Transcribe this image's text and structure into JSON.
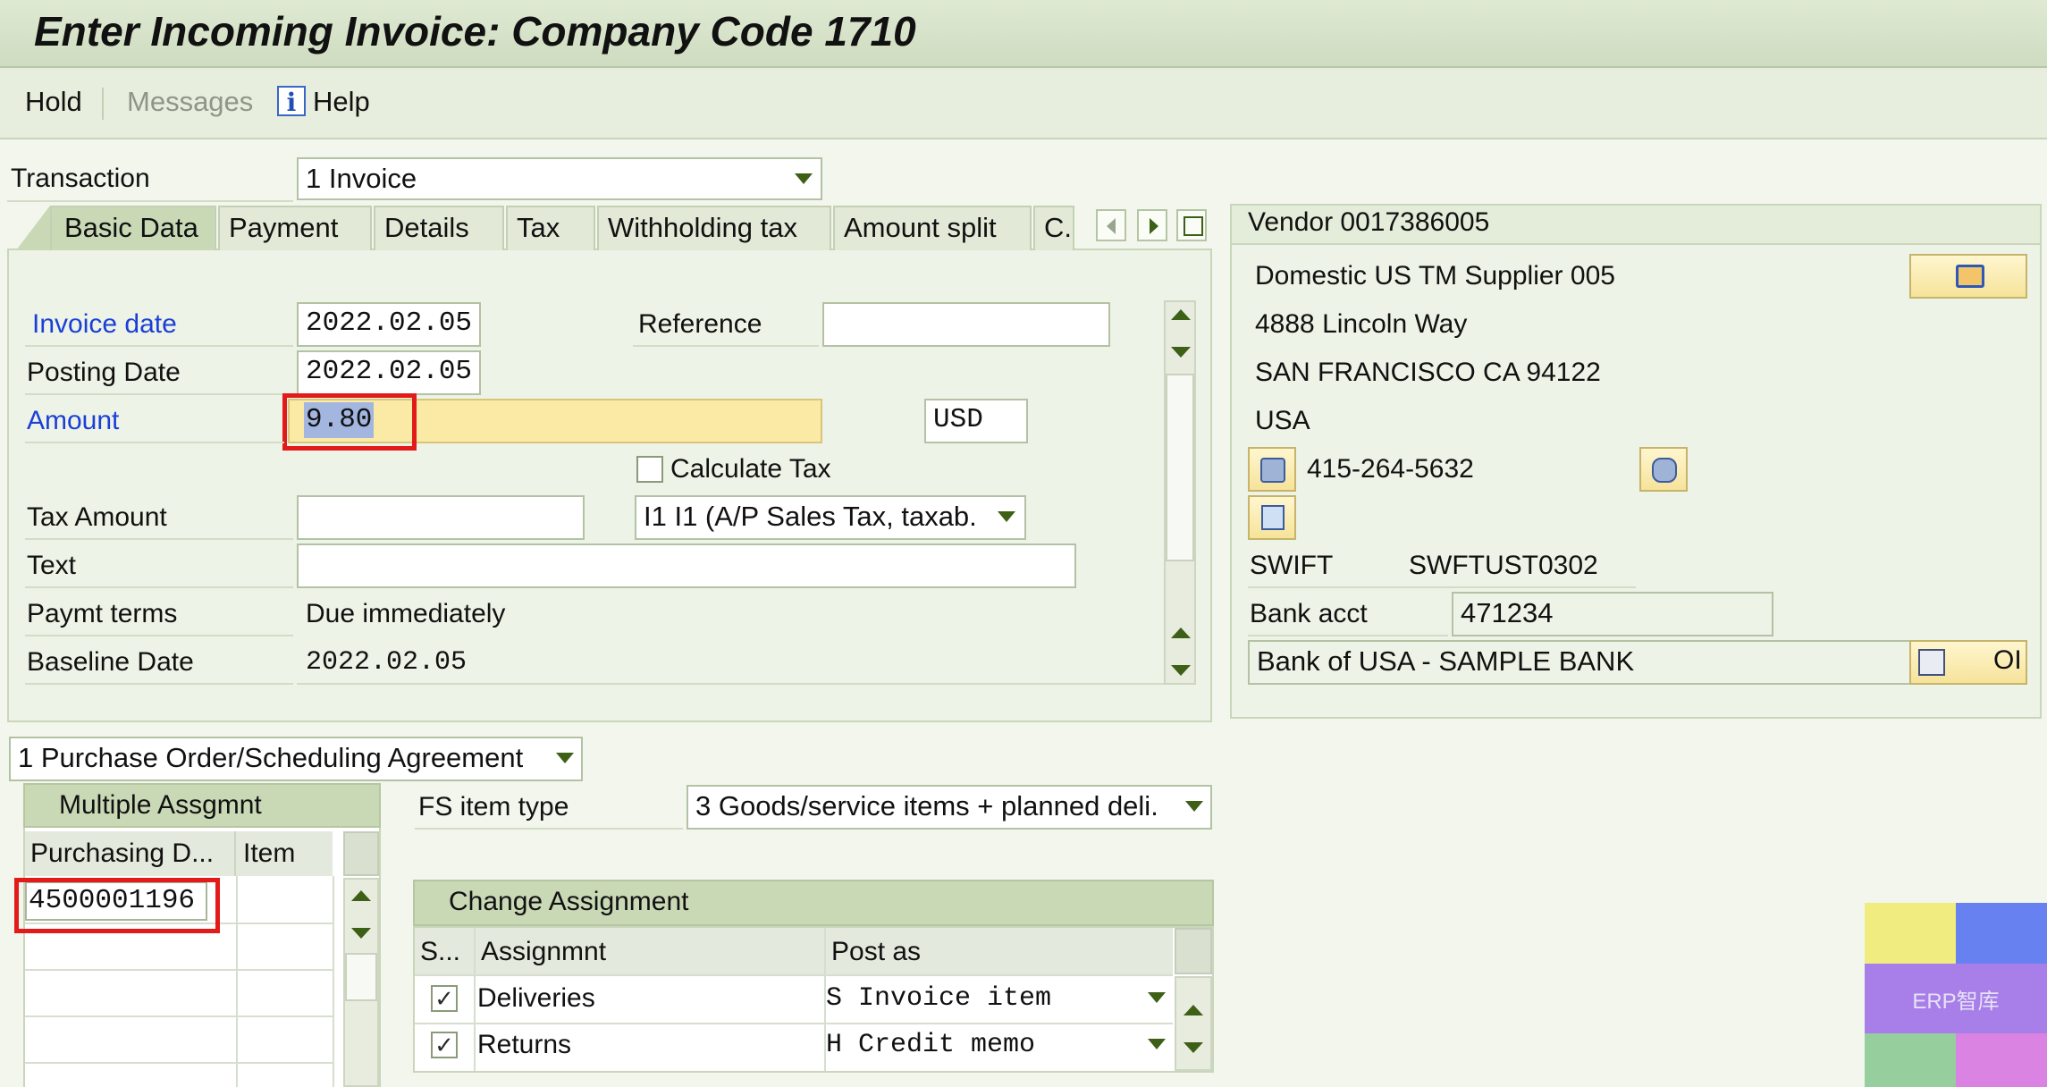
{
  "window": {
    "title": "Enter Incoming Invoice: Company Code 1710"
  },
  "toolbar": {
    "hold": "Hold",
    "messages": "Messages",
    "help": "Help"
  },
  "transaction": {
    "label": "Transaction",
    "value": "1 Invoice"
  },
  "tabs": [
    "Basic Data",
    "Payment",
    "Details",
    "Tax",
    "Withholding tax",
    "Amount split",
    "C."
  ],
  "basic_data": {
    "invoice_date_label": "Invoice date",
    "invoice_date": "2022.02.05",
    "reference_label": "Reference",
    "reference": "",
    "posting_date_label": "Posting Date",
    "posting_date": "2022.02.05",
    "amount_label": "Amount",
    "amount": "9.80",
    "currency": "USD",
    "calc_tax_label": "Calculate Tax",
    "tax_amount_label": "Tax Amount",
    "tax_amount": "",
    "tax_code": "I1 I1 (A/P Sales Tax, taxab.",
    "text_label": "Text",
    "text": "",
    "paymt_terms_label": "Paymt terms",
    "paymt_terms": "Due immediately",
    "baseline_date_label": "Baseline Date",
    "baseline_date": "2022.02.05"
  },
  "vendor": {
    "header": "Vendor 0017386005",
    "name": "Domestic US TM Supplier 005",
    "street": "4888 Lincoln Way",
    "city": "SAN FRANCISCO CA  94122",
    "country": "USA",
    "phone": "415-264-5632",
    "swift_label": "SWIFT",
    "swift": "SWFTUST0302",
    "bank_acct_label": "Bank acct",
    "bank_acct": "471234",
    "bank_name": "Bank of USA - SAMPLE BANK",
    "oi_label": "OI"
  },
  "reference_doc": {
    "value": "1 Purchase Order/Scheduling Agreement"
  },
  "multiple_assignment": {
    "header": "Multiple Assgmnt",
    "col_purchasing_doc": "Purchasing D...",
    "col_item": "Item",
    "rows": [
      {
        "doc": "4500001196",
        "item": ""
      }
    ]
  },
  "fs_item_type": {
    "label": "FS item type",
    "value": "3 Goods/service items + planned deli."
  },
  "change_assignment": {
    "header": "Change Assignment",
    "col_s": "S...",
    "col_assignment": "Assignmnt",
    "col_post_as": "Post as",
    "rows": [
      {
        "checked": "✓",
        "assignment": "Deliveries",
        "post_as": "S Invoice item"
      },
      {
        "checked": "✓",
        "assignment": "Returns",
        "post_as": "H Credit memo"
      }
    ]
  },
  "watermark": {
    "text": "ERP智库",
    "colors": [
      "#f0ea6c",
      "#4f6df0",
      "#9b68e8",
      "#86c78e",
      "#d66ee0"
    ]
  }
}
